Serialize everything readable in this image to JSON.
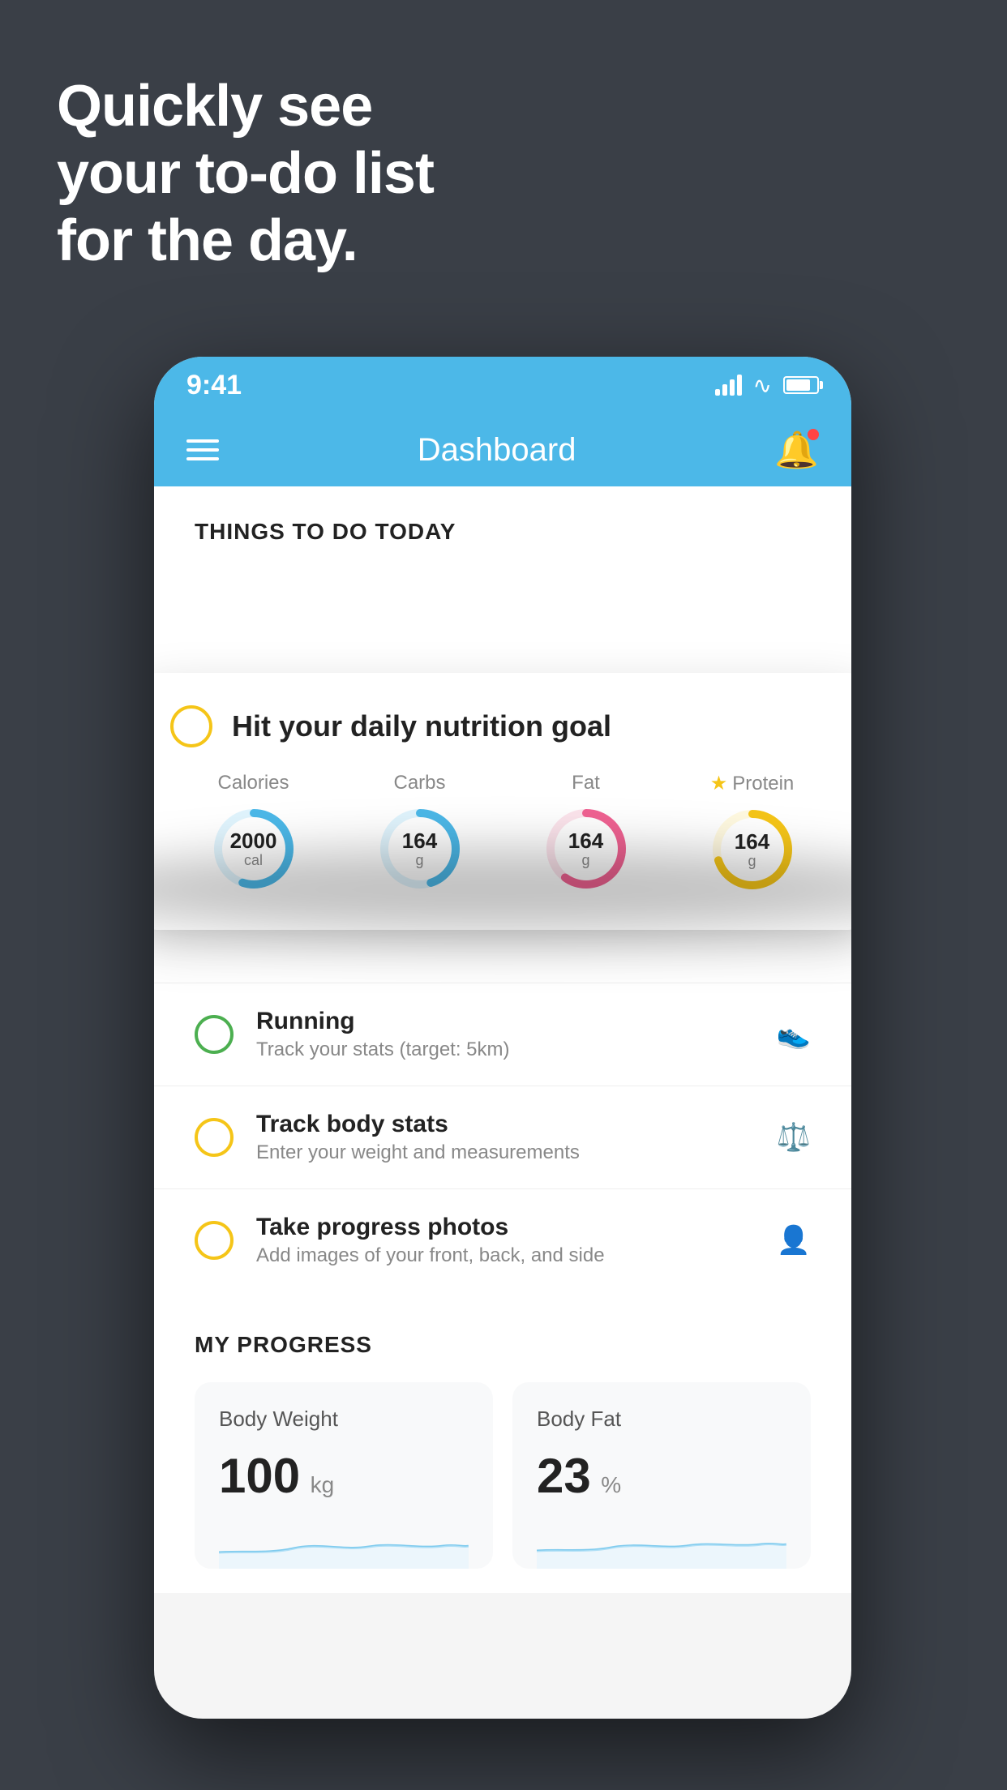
{
  "headline": {
    "line1": "Quickly see",
    "line2": "your to-do list",
    "line3": "for the day."
  },
  "status_bar": {
    "time": "9:41"
  },
  "nav": {
    "title": "Dashboard"
  },
  "todo_section": {
    "heading": "THINGS TO DO TODAY"
  },
  "floating_card": {
    "title": "Hit your daily nutrition goal",
    "items": [
      {
        "label": "Calories",
        "value": "2000",
        "unit": "cal",
        "color": "#4cb8e8",
        "track_color": "#e0f4fd",
        "percent": 55
      },
      {
        "label": "Carbs",
        "value": "164",
        "unit": "g",
        "color": "#4cb8e8",
        "track_color": "#e0f4fd",
        "percent": 45
      },
      {
        "label": "Fat",
        "value": "164",
        "unit": "g",
        "color": "#f06292",
        "track_color": "#fce4ec",
        "percent": 60
      },
      {
        "label": "Protein",
        "value": "164",
        "unit": "g",
        "color": "#f5c518",
        "track_color": "#fff9e0",
        "percent": 70,
        "starred": true
      }
    ]
  },
  "todo_items": [
    {
      "title": "Running",
      "subtitle": "Track your stats (target: 5km)",
      "circle_color": "green",
      "icon": "👟"
    },
    {
      "title": "Track body stats",
      "subtitle": "Enter your weight and measurements",
      "circle_color": "yellow",
      "icon": "⚖️"
    },
    {
      "title": "Take progress photos",
      "subtitle": "Add images of your front, back, and side",
      "circle_color": "yellow",
      "icon": "👤"
    }
  ],
  "progress_section": {
    "heading": "MY PROGRESS",
    "cards": [
      {
        "title": "Body Weight",
        "value": "100",
        "unit": "kg"
      },
      {
        "title": "Body Fat",
        "value": "23",
        "unit": "%"
      }
    ]
  }
}
